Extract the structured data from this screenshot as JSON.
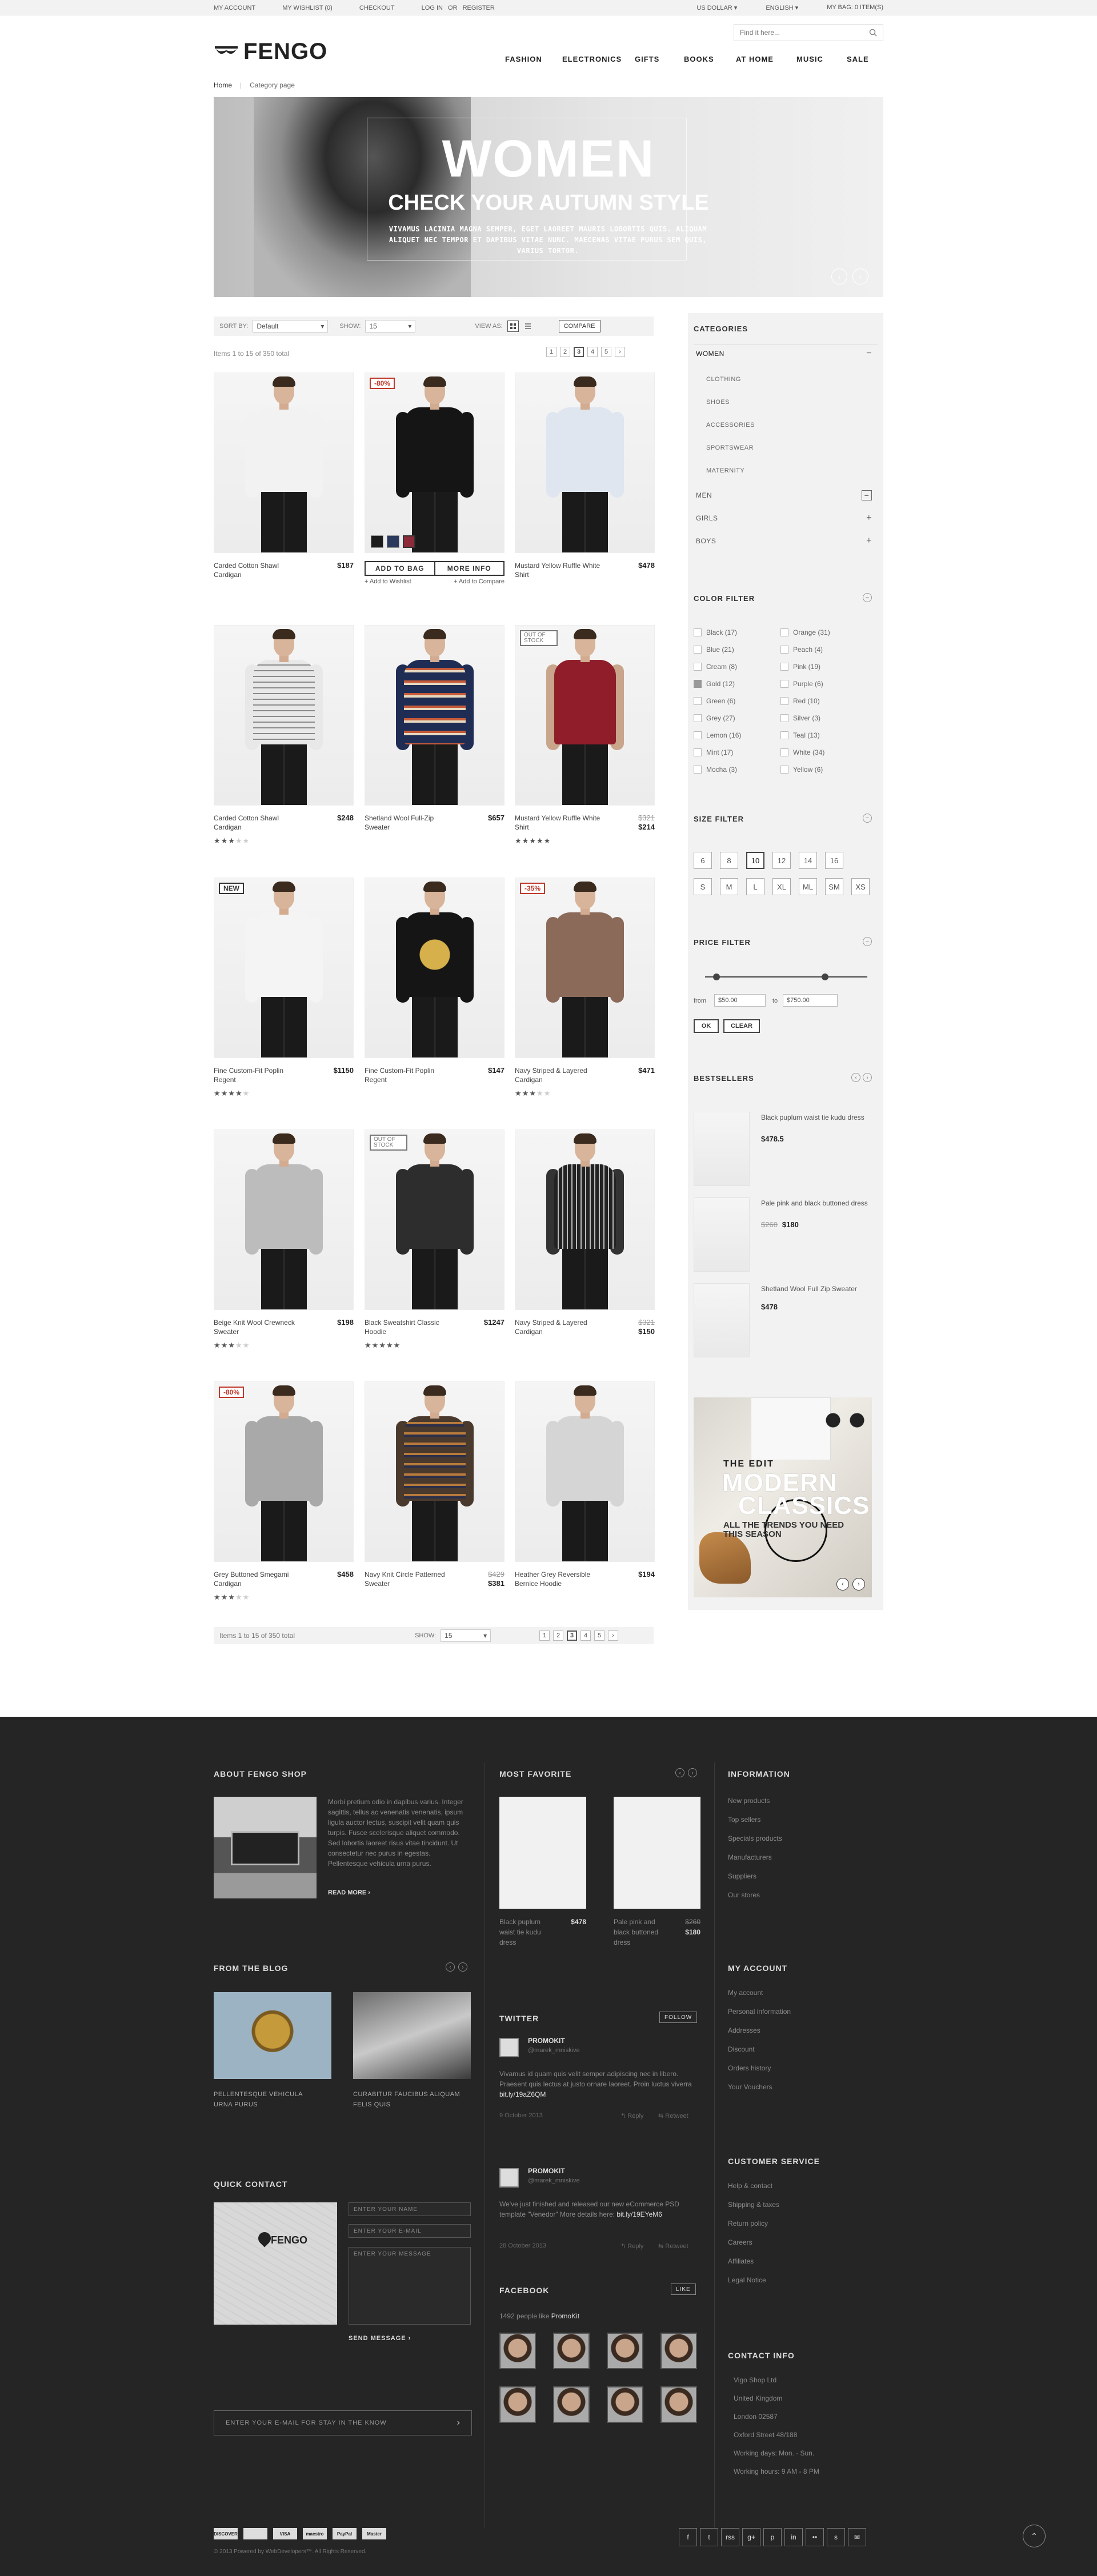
{
  "topbar": {
    "left": [
      "My account",
      "My wishlist (0)",
      "Checkout",
      "Log in",
      "or",
      "Register"
    ],
    "currency": "US DOLLAR ▾",
    "language": "ENGLISH ▾",
    "bag": "MY BAG: 0 ITEM(S)"
  },
  "header": {
    "logo": "FENGO",
    "search_placeholder": "Find it here...",
    "nav": [
      "FASHION",
      "ELECTRONICS",
      "GIFTS",
      "BOOKS",
      "AT HOME",
      "MUSIC",
      "SALE"
    ]
  },
  "breadcrumb": [
    "Home",
    "Category page"
  ],
  "hero": {
    "title": "WOMEN",
    "subtitle": "CHECK YOUR AUTUMN STYLE",
    "text": "VIVAMUS LACINIA MAGNA SEMPER, EGET LAOREET MAURIS LOBORTIS QUIS. ALIQUAM ALIQUET NEC TEMPOR ET DAPIBUS VITAE NUNC. MAECENAS VITAE PURUS SEM QUIS, VARIUS TORTOR."
  },
  "toolbar": {
    "sort_label": "SORT BY:",
    "sort_value": "Default",
    "show_label": "SHOW:",
    "show_value": "15",
    "view_label": "VIEW AS:",
    "compare": "COMPARE",
    "count": "Items 1 to 15 of 350 total",
    "pages": [
      "1",
      "2",
      "3",
      "4",
      "5",
      "›"
    ],
    "current_page": "3"
  },
  "products": [
    {
      "name": "Carded Cotton Shawl Cardigan",
      "price": "$187",
      "old": "",
      "badge": "",
      "stars": 0
    },
    {
      "name": "",
      "price": "",
      "old": "",
      "badge": "-80%",
      "stars": 0
    },
    {
      "name": "Mustard Yellow Ruffle White Shirt",
      "price": "$478",
      "old": "",
      "badge": "",
      "stars": 0
    },
    {
      "name": "Carded Cotton Shawl Cardigan",
      "price": "$248",
      "old": "",
      "badge": "",
      "stars": 3
    },
    {
      "name": "Shetland Wool Full-Zip Sweater",
      "price": "$657",
      "old": "",
      "badge": "",
      "stars": 0
    },
    {
      "name": "Mustard Yellow Ruffle White Shirt",
      "price": "$214",
      "old": "$321",
      "badge": "OUT OF STOCK",
      "stars": 5
    },
    {
      "name": "Fine Custom-Fit Poplin Regent",
      "price": "$1150",
      "old": "",
      "badge": "NEW",
      "stars": 4
    },
    {
      "name": "Fine Custom-Fit Poplin Regent",
      "price": "$147",
      "old": "",
      "badge": "",
      "stars": 0
    },
    {
      "name": "Navy Striped & Layered Cardigan",
      "price": "$471",
      "old": "",
      "badge": "-35%",
      "stars": 3
    },
    {
      "name": "Beige Knit Wool Crewneck Sweater",
      "price": "$198",
      "old": "",
      "badge": "",
      "stars": 3
    },
    {
      "name": "Black Sweatshirt Classic Hoodie",
      "price": "$1247",
      "old": "",
      "badge": "OUT OF STOCK",
      "stars": 5
    },
    {
      "name": "Navy Striped & Layered Cardigan",
      "price": "$150",
      "old": "$321",
      "badge": "",
      "stars": 0
    },
    {
      "name": "Grey Buttoned Smegami Cardigan",
      "price": "$458",
      "old": "",
      "badge": "-80%",
      "stars": 3
    },
    {
      "name": "Navy Knit Circle Patterned Sweater",
      "price": "$381",
      "old": "$429",
      "badge": "",
      "stars": 0
    },
    {
      "name": "Heather Grey Reversible Bernice Hoodie",
      "price": "$194",
      "old": "",
      "badge": "",
      "stars": 0
    }
  ],
  "hover_product": {
    "add_to_bag": "ADD TO BAG",
    "more_info": "MORE INFO",
    "wishlist": "+ Add to Wishlist",
    "compare": "+ Add to Compare",
    "swatch_colors": [
      "#1c1c1c",
      "#2b3a5c",
      "#8e2b3a"
    ]
  },
  "sidebar": {
    "categories_title": "CATEGORIES",
    "categories": [
      "WOMEN",
      "MEN",
      "GIRLS",
      "BOYS"
    ],
    "subcategories": [
      "CLOTHING",
      "SHOES",
      "ACCESSORIES",
      "SPORTSWEAR",
      "MATERNITY"
    ],
    "color_title": "COLOR FILTER",
    "colors_left": [
      "Black (17)",
      "Blue (21)",
      "Cream (8)",
      "Gold (12)",
      "Green (6)",
      "Grey (27)",
      "Lemon (16)",
      "Mint (17)",
      "Mocha (3)"
    ],
    "colors_right": [
      "Orange (31)",
      "Peach (4)",
      "Pink (19)",
      "Purple (6)",
      "Red (10)",
      "Silver (3)",
      "Teal (13)",
      "White (34)",
      "Yellow (6)"
    ],
    "size_title": "SIZE FILTER",
    "sizes_row1": [
      "6",
      "8",
      "10",
      "12",
      "14",
      "16"
    ],
    "sizes_row2": [
      "S",
      "M",
      "L",
      "XL",
      "ML",
      "SM",
      "XS"
    ],
    "price_title": "PRICE FILTER",
    "price_from_label": "from",
    "price_from": "$50.00",
    "price_to_label": "to",
    "price_to": "$750.00",
    "ok": "OK",
    "clear": "CLEAR",
    "bestsellers_title": "BESTSELLERS",
    "bestsellers": [
      {
        "name": "Black puplum waist tie kudu dress",
        "price": "$478.5",
        "old": ""
      },
      {
        "name": "Pale pink and black buttoned dress",
        "price": "$180",
        "old": "$260"
      },
      {
        "name": "Shetland Wool Full Zip Sweater",
        "price": "$478",
        "old": ""
      }
    ],
    "promo": {
      "line1": "THE EDIT",
      "line2": "MODERN",
      "line3": "CLASSICS",
      "line4": "ALL THE TRENDS YOU NEED THIS SEASON"
    }
  },
  "footer": {
    "about_title": "ABOUT FENGO SHOP",
    "about_text": "Morbi pretium odio in dapibus varius. Integer sagittis, tellus ac venenatis venenatis, ipsum ligula auctor lectus, suscipit velit quam quis turpis. Fusce scelerisque aliquet commodo. Sed lobortis laoreet risus vitae tincidunt. Ut consectetur nec purus in egestas. Pellentesque vehicula urna purus.",
    "read_more": "READ MORE ›",
    "favorite_title": "MOST FAVORITE",
    "favorites": [
      {
        "name": "Black puplum waist tie kudu dress",
        "price": "$478",
        "old": ""
      },
      {
        "name": "Pale pink and black buttoned dress",
        "price": "$180",
        "old": "$260"
      }
    ],
    "info_title": "INFORMATION",
    "info_links": [
      "New products",
      "Top sellers",
      "Specials products",
      "Manufacturers",
      "Suppliers",
      "Our stores"
    ],
    "blog_title": "FROM THE BLOG",
    "blog": [
      "PELLENTESQUE VEHICULA URNA PURUS",
      "CURABITUR FAUCIBUS ALIQUAM FELIS QUIS"
    ],
    "twitter_title": "TWITTER",
    "follow": "FOLLOW",
    "tweets": [
      {
        "user": "PROMOKIT",
        "handle": "@marek_mniskive",
        "text": "Vivamus id quam quis velit semper adipiscing nec in libero. Praesent quis lectus at justo ornare laoreet. Proin luctus viverra",
        "link": "bit.ly/19aZ6QM",
        "date": "9 October 2013",
        "reply": "↰ Reply",
        "retweet": "⇆ Retweet"
      },
      {
        "user": "PROMOKIT",
        "handle": "@marek_mniskive",
        "text": "We've just finished and released our new eCommerce PSD template \"Venedor\" More details here:",
        "link": "bit.ly/19EYeM6",
        "date": "28 October 2013",
        "reply": "↰ Reply",
        "retweet": "⇆ Retweet"
      }
    ],
    "account_title": "MY ACCOUNT",
    "account_links": [
      "My account",
      "Personal information",
      "Addresses",
      "Discount",
      "Orders history",
      "Your Vouchers"
    ],
    "contact_form_title": "QUICK CONTACT",
    "contact_name": "ENTER YOUR NAME",
    "contact_email": "ENTER YOUR E-MAIL",
    "contact_message": "ENTER YOUR MESSAGE",
    "send": "SEND MESSAGE ›",
    "map_label": "FENGO",
    "service_title": "CUSTOMER SERVICE",
    "service_links": [
      "Help & contact",
      "Shipping & taxes",
      "Return policy",
      "Careers",
      "Affiliates",
      "Legal Notice"
    ],
    "facebook_title": "FACEBOOK",
    "like": "LIKE",
    "fb_count": "1492 people like",
    "fb_name": "PromoKit",
    "contact_info_title": "CONTACT INFO",
    "contact_info": [
      "Vigo Shop Ltd",
      "United Kingdom",
      "London 02587",
      "Oxford Street 48/188",
      "Working days: Mon. - Sun.",
      "Working hours: 9 AM - 8 PM"
    ],
    "newsletter": "ENTER YOUR E-MAIL FOR STAY IN THE KNOW",
    "payments": [
      "DISCOVER",
      "",
      "VISA",
      "maestro",
      "PayPal",
      "Master"
    ],
    "copyright": "© 2013 Powered by WebDevelopers™. All Rights Reserved.",
    "social": [
      "f",
      "t",
      "rss",
      "g+",
      "p",
      "in",
      "••",
      "s",
      "✉"
    ]
  }
}
